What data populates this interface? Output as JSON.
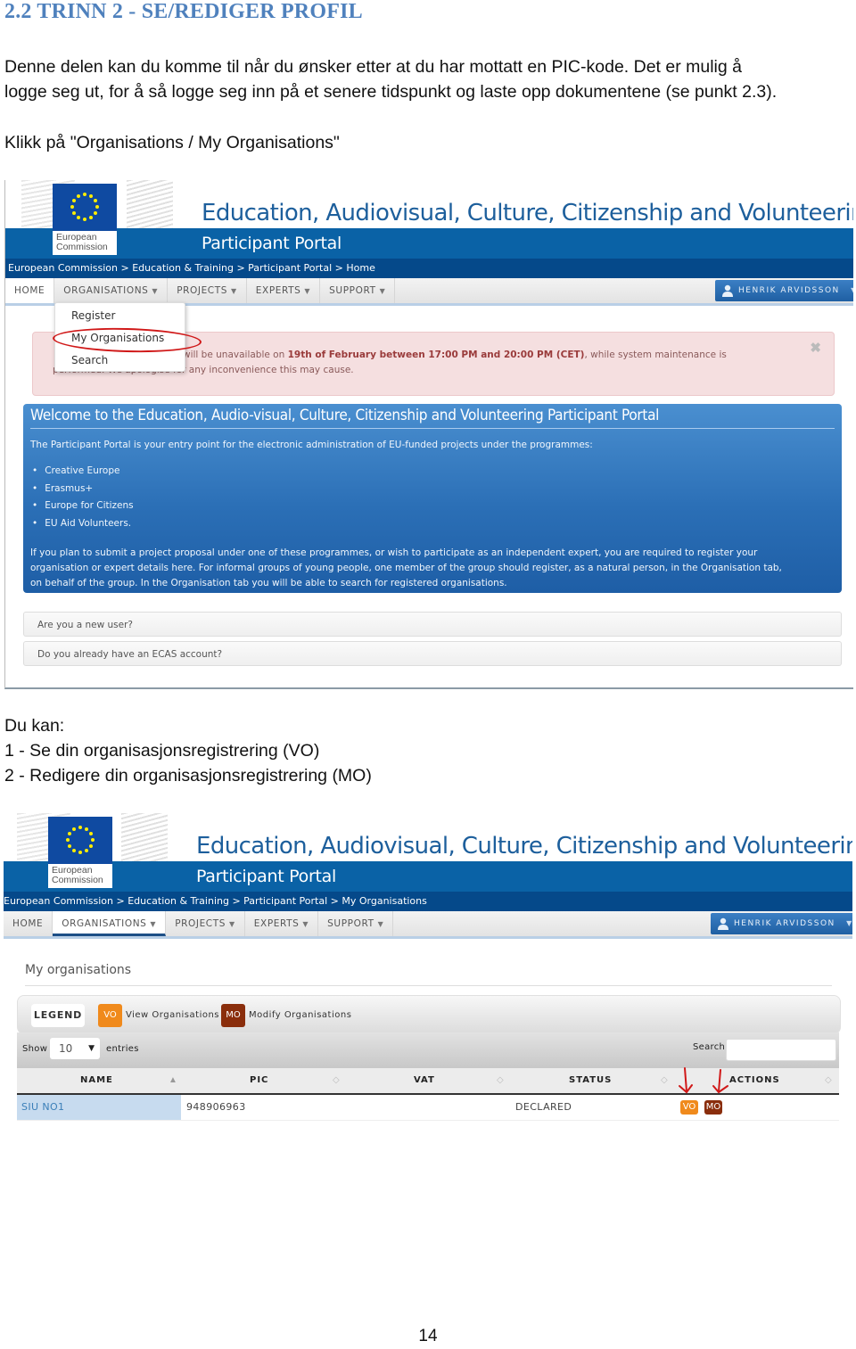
{
  "document": {
    "heading": "2.2 TRINN 2 - SE/REDIGER PROFIL",
    "intro_line1": "Denne delen kan du komme til når du ønsker etter at du har mottatt en PIC-kode. Det er mulig å",
    "intro_line2": "logge seg ut, for å så logge seg inn på et senere tidspunkt og laste opp dokumentene (se punkt 2.3).",
    "instruction": "Klikk på \"Organisations / My Organisations\"",
    "du_kan": "Du kan:",
    "option1": "1 - Se din organisasjonsregistrering (VO)",
    "option2": "2 - Redigere din organisasjonsregistrering (MO)",
    "page_number": "14"
  },
  "portal": {
    "ec_logo_line1": "European",
    "ec_logo_line2": "Commission",
    "site_title": "Education, Audiovisual, Culture, Citizenship and Volunteering",
    "portal_title": "Participant Portal",
    "nav": {
      "home": "HOME",
      "organisations": "ORGANISATIONS",
      "projects": "PROJECTS",
      "experts": "EXPERTS",
      "support": "SUPPORT",
      "caret": "▼"
    },
    "user_name": "HENRIK ARVIDSSON"
  },
  "screenshot1": {
    "breadcrumb": "European Commission >  Education & Training >  Participant Portal >  Home",
    "dropdown": {
      "items": [
        "Register",
        "My Organisations",
        "Search"
      ],
      "highlighted": "My Organisations"
    },
    "alert": {
      "line1_start": "will be unavailable on ",
      "line1_bold": "19th of February between 17:00 PM and 20:00 PM (CET)",
      "line1_end": ", while system maintenance is",
      "line2": "performed. We apologise for any inconvenience this may cause.",
      "close_glyph": "✖"
    },
    "welcome": {
      "title": "Welcome to the Education, Audio-visual, Culture, Citizenship and Volunteering Participant Portal",
      "intro": "The Participant Portal is your entry point for the electronic administration of EU-funded projects under the programmes:",
      "programmes": [
        "Creative Europe",
        "Erasmus+",
        "Europe for Citizens",
        "EU Aid Volunteers."
      ],
      "body_line1": "If you plan to submit a project proposal under one of these programmes, or wish to participate as an independent expert, you are required to register your",
      "body_line2": "organisation or expert details here. For informal groups of young people, one member of the group should register, as a natural person, in the Organisation tab,",
      "body_line3": "on behalf of the group. In the Organisation tab you will be able to search for registered organisations."
    },
    "accordion": [
      "Are you a new user?",
      "Do you already have an ECAS account?"
    ]
  },
  "screenshot2": {
    "breadcrumb": "European Commission >  Education & Training >  Participant Portal >  My Organisations",
    "page_title": "My organisations",
    "legend": {
      "label": "LEGEND",
      "vo_badge": "VO",
      "vo_text": "View Organisations",
      "mo_badge": "MO",
      "mo_text": "Modify Organisations"
    },
    "table_tools": {
      "show": "Show",
      "entries_value": "10",
      "entries": "entries",
      "search": "Search",
      "search_value": ""
    },
    "columns": [
      "NAME",
      "PIC",
      "VAT",
      "STATUS",
      "ACTIONS"
    ],
    "rows": [
      {
        "name": "SIU NO1",
        "pic": "948906963",
        "vat": "",
        "status": "DECLARED",
        "actions": [
          "VO",
          "MO"
        ]
      }
    ]
  },
  "colors": {
    "heading": "#4f81bd",
    "portal_blue": "#0a62a6",
    "vo_orange": "#f08a1c",
    "mo_brown": "#8a2e0c",
    "annotation_red": "#d01818"
  }
}
